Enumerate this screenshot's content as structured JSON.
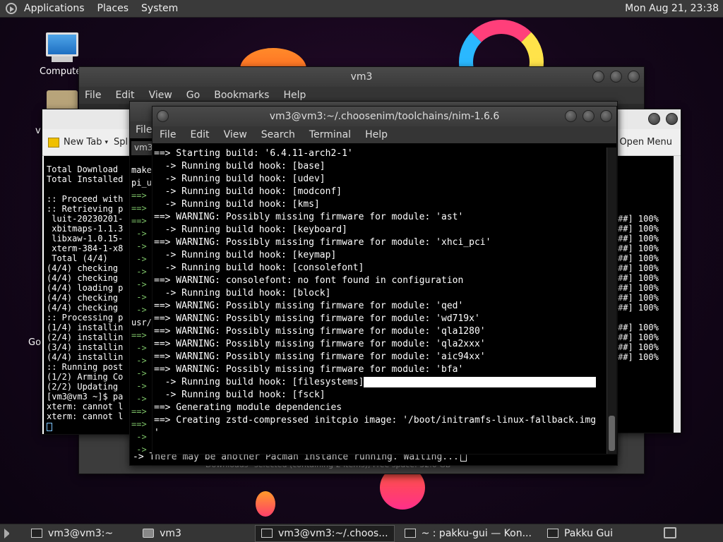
{
  "top_panel": {
    "menus": [
      "Applications",
      "Places",
      "System"
    ],
    "clock": "Mon Aug 21, 23:38"
  },
  "desktop": {
    "icons": [
      {
        "label": "Compute"
      },
      {
        "label": "Go"
      },
      {
        "label": "v"
      }
    ]
  },
  "file_manager": {
    "title": "vm3",
    "menu": [
      "File",
      "Edit",
      "View",
      "Go",
      "Bookmarks",
      "Help"
    ],
    "status": "\"Downloads\" selected (containing 2 items), Free space: 32.0 GB"
  },
  "konsole_left": {
    "new_tab": "New Tab",
    "split": "Spl",
    "lines": [
      "Total Download",
      "Total Installed",
      "",
      ":: Proceed with",
      ":: Retrieving p",
      " luit-20230201-",
      " xbitmaps-1.1.3",
      " libxaw-1.0.15-",
      " xterm-384-1-x8",
      " Total (4/4)",
      "(4/4) checking",
      "(4/4) checking",
      "(4/4) loading p",
      "(4/4) checking",
      "(4/4) checking",
      ":: Processing p",
      "(1/4) installin",
      "(2/4) installin",
      "(3/4) installin",
      "(4/4) installin",
      ":: Running post",
      "(1/2) Arming Co",
      "(2/2) Updating",
      "[vm3@vm3 ~]$ pa",
      "xterm: cannot l",
      "xterm: cannot l"
    ]
  },
  "konsole_right": {
    "open_menu": "Open Menu",
    "lines": [
      "##] 100%",
      "##] 100%",
      "##] 100%",
      "##] 100%",
      "##] 100%",
      "##] 100%",
      "##] 100%",
      "##] 100%",
      "##] 100%",
      "##] 100%",
      "",
      "##] 100%",
      "##] 100%",
      "##] 100%",
      "##] 100%"
    ]
  },
  "middle_term": {
    "menu_file": "File",
    "tab": "vm3",
    "lines": [
      "make",
      "pi_u",
      "==>",
      "==>",
      "==>",
      " ->",
      " ->",
      " ->",
      " ->",
      " ->",
      " ->",
      " ->",
      "usr/",
      "==>",
      " ->",
      " ->",
      " ->",
      " ->",
      " ->",
      "==>",
      "==>",
      " ->",
      " ->"
    ],
    "last_line": "-> There may be another Pacman instance running. Waiting..."
  },
  "front_term": {
    "title": "vm3@vm3:~/.choosenim/toolchains/nim-1.6.6",
    "menu": [
      "File",
      "Edit",
      "View",
      "Search",
      "Terminal",
      "Help"
    ],
    "lines": [
      "==> Starting build: '6.4.11-arch2-1'",
      "  -> Running build hook: [base]",
      "  -> Running build hook: [udev]",
      "  -> Running build hook: [modconf]",
      "  -> Running build hook: [kms]",
      "==> WARNING: Possibly missing firmware for module: 'ast'",
      "  -> Running build hook: [keyboard]",
      "==> WARNING: Possibly missing firmware for module: 'xhci_pci'",
      "  -> Running build hook: [keymap]",
      "  -> Running build hook: [consolefont]",
      "==> WARNING: consolefont: no font found in configuration",
      "  -> Running build hook: [block]",
      "==> WARNING: Possibly missing firmware for module: 'qed'",
      "==> WARNING: Possibly missing firmware for module: 'wd719x'",
      "==> WARNING: Possibly missing firmware for module: 'qla1280'",
      "==> WARNING: Possibly missing firmware for module: 'qla2xxx'",
      "==> WARNING: Possibly missing firmware for module: 'aic94xx'",
      "==> WARNING: Possibly missing firmware for module: 'bfa'",
      "  -> Running build hook: [filesystems]",
      "  -> Running build hook: [fsck]",
      "==> Generating module dependencies",
      "==> Creating zstd-compressed initcpio image: '/boot/initramfs-linux-fallback.img",
      "'"
    ]
  },
  "taskbar": {
    "tasks": [
      {
        "label": "vm3@vm3:~"
      },
      {
        "label": "vm3"
      },
      {
        "label": "vm3@vm3:~/.choos..."
      },
      {
        "label": "~ : pakku-gui — Kon..."
      },
      {
        "label": "Pakku Gui"
      }
    ]
  }
}
